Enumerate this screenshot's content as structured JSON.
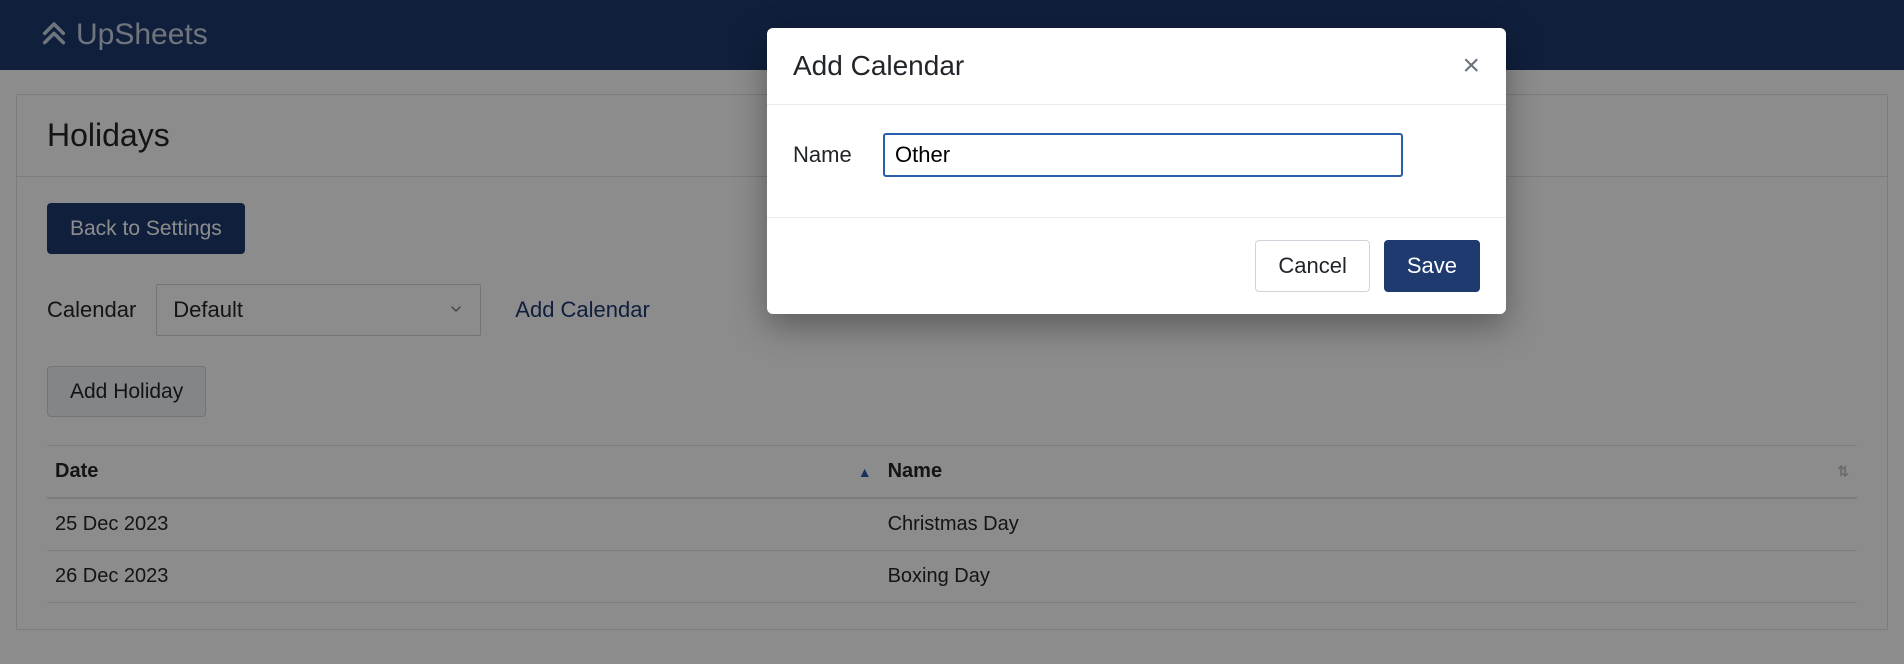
{
  "brand": "UpSheets",
  "page": {
    "title": "Holidays",
    "back_button": "Back to Settings",
    "calendar_label": "Calendar",
    "calendar_selected": "Default",
    "add_calendar_link": "Add Calendar",
    "add_holiday_button": "Add Holiday"
  },
  "table": {
    "headers": {
      "date": "Date",
      "name": "Name"
    },
    "rows": [
      {
        "date": "25 Dec 2023",
        "name": "Christmas Day"
      },
      {
        "date": "26 Dec 2023",
        "name": "Boxing Day"
      }
    ]
  },
  "modal": {
    "title": "Add Calendar",
    "name_label": "Name",
    "name_value": "Other",
    "cancel": "Cancel",
    "save": "Save"
  }
}
